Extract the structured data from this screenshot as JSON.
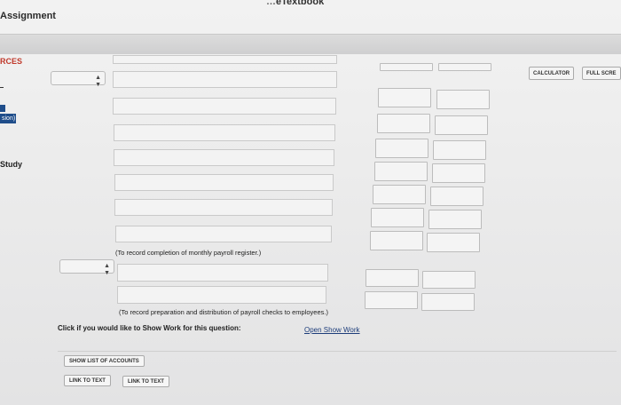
{
  "header": {
    "top_title": "eTextbook",
    "assignment_title": "Assignment"
  },
  "sidebar": {
    "resources_label": "RCES",
    "session_label": "sion)",
    "study_label": "Study"
  },
  "toolbar": {
    "calculator_label": "CALCULATOR",
    "full_screen_label": "FULL SCRE"
  },
  "entries": {
    "note_payroll": "(To record completion of monthly payroll register.)",
    "note_checks": "(To record preparation and distribution of payroll checks to employees.)"
  },
  "show_work": {
    "prompt": "Click if you would like to Show Work for this question:",
    "link": "Open Show Work"
  },
  "accounts": {
    "show_list_label": "SHOW LIST OF ACCOUNTS",
    "link_to_text_1": "LINK TO TEXT",
    "link_to_text_2": "LINK TO TEXT"
  },
  "icons": {
    "select_arrow": "updown-arrow-icon"
  }
}
